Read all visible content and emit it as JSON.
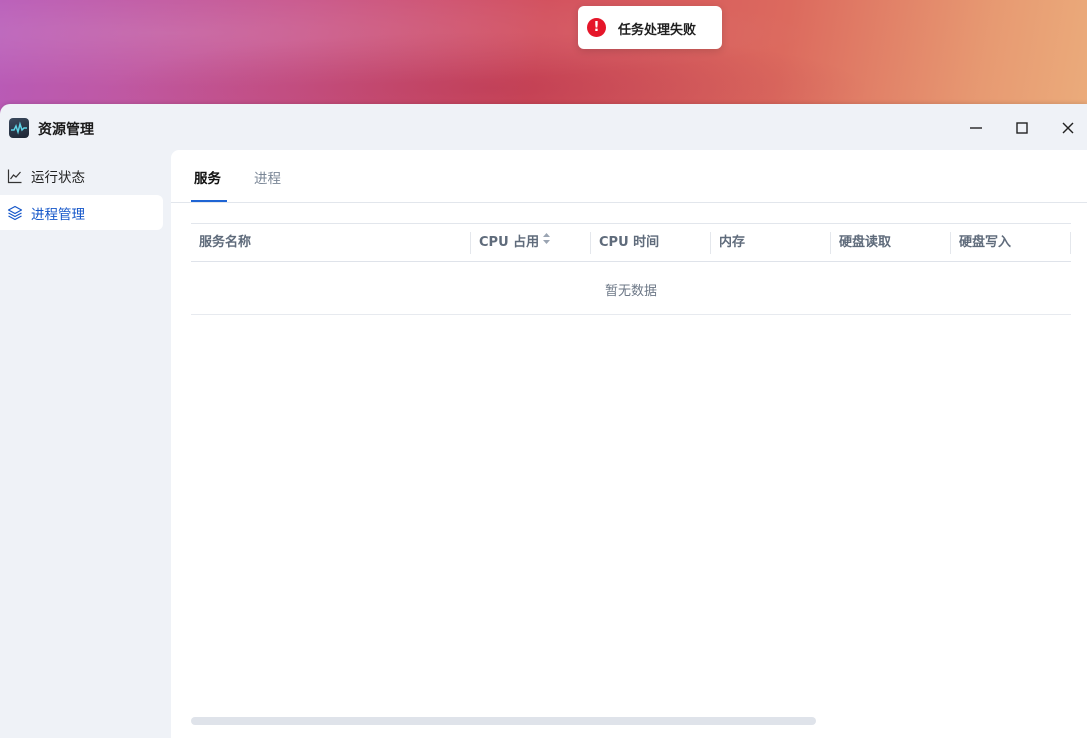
{
  "toast": {
    "icon": "error-icon",
    "message": "任务处理失败",
    "color": "#e5162a"
  },
  "window": {
    "title": "资源管理",
    "icon": "resource-monitor-icon",
    "controls": {
      "minimize": "minimize-icon",
      "maximize": "maximize-icon",
      "close": "close-icon"
    }
  },
  "sidebar": {
    "items": [
      {
        "label": "运行状态",
        "icon": "line-chart-icon",
        "active": false
      },
      {
        "label": "进程管理",
        "icon": "layers-icon",
        "active": true
      }
    ]
  },
  "main": {
    "tabs": [
      {
        "label": "服务",
        "active": true
      },
      {
        "label": "进程",
        "active": false
      }
    ],
    "table": {
      "columns": [
        "服务名称",
        "CPU 占用",
        "CPU 时间",
        "内存",
        "硬盘读取",
        "硬盘写入"
      ],
      "sortable_column": "CPU 占用",
      "empty_text": "暂无数据"
    }
  },
  "colors": {
    "accent": "#1e64d4",
    "sidebar_active_text": "#1456c9",
    "window_bg": "#eff2f7"
  }
}
